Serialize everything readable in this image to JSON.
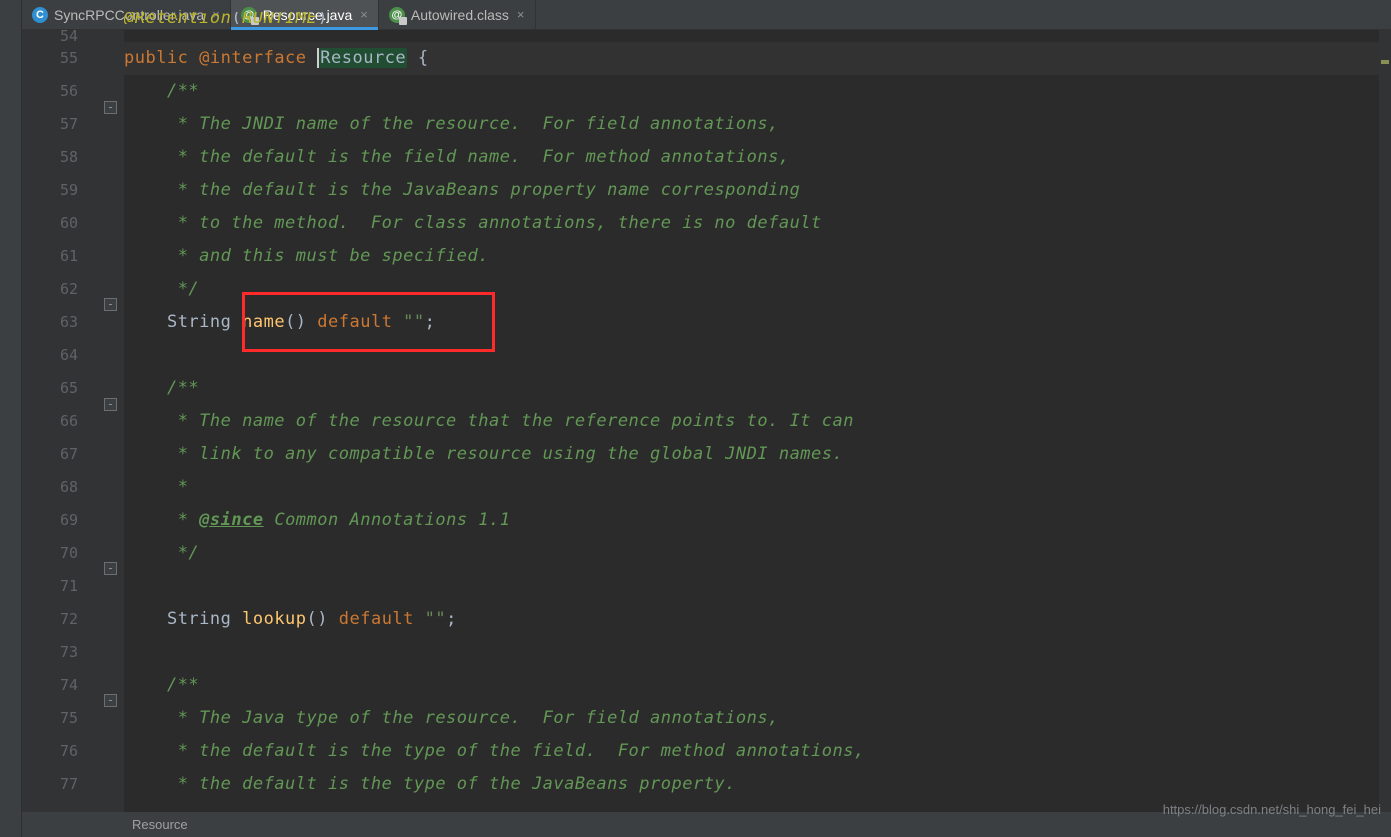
{
  "tabs": [
    {
      "icon": "class-icon",
      "label": "SyncRPCController.java",
      "active": false,
      "locked": false
    },
    {
      "icon": "annotation-icon",
      "label": "Resource.java",
      "active": true,
      "locked": true
    },
    {
      "icon": "annotation-icon",
      "label": "Autowired.class",
      "active": false,
      "locked": true
    }
  ],
  "line_numbers": [
    "54",
    "55",
    "56",
    "57",
    "58",
    "59",
    "60",
    "61",
    "62",
    "63",
    "64",
    "65",
    "66",
    "67",
    "68",
    "69",
    "70",
    "71",
    "72",
    "73",
    "74",
    "75",
    "76",
    "77"
  ],
  "fold_markers": [
    {
      "line": 54,
      "kind": "end"
    },
    {
      "line": 56,
      "kind": "start"
    },
    {
      "line": 62,
      "kind": "end"
    },
    {
      "line": 65,
      "kind": "start"
    },
    {
      "line": 70,
      "kind": "end"
    },
    {
      "line": 74,
      "kind": "start"
    }
  ],
  "code": {
    "l54": {
      "ann": "@Retention",
      "ann2": "RUNTIME"
    },
    "l55": {
      "kw1": "public",
      "kw2": "@interface",
      "id": "Resource",
      "brace": " {"
    },
    "l56": "/**",
    "l57": " * The JNDI name of the resource.  For field annotations,",
    "l58": " * the default is the field name.  For method annotations,",
    "l59": " * the default is the JavaBeans property name corresponding",
    "l60": " * to the method.  For class annotations, there is no default",
    "l61": " * and this must be specified.",
    "l62": " */",
    "l63": {
      "t": "String ",
      "m": "name",
      "p": "() ",
      "kw": "default ",
      "s": "\"\"",
      "e": ";"
    },
    "l64": "",
    "l65": "/**",
    "l66": " * The name of the resource that the reference points to. It can",
    "l67": " * link to any compatible resource using the global JNDI names.",
    "l68": " *",
    "l69a": " * ",
    "l69b": "@since",
    "l69c": " Common Annotations 1.1",
    "l70": " */",
    "l71": "",
    "l72": {
      "t": "String ",
      "m": "lookup",
      "p": "() ",
      "kw": "default ",
      "s": "\"\"",
      "e": ";"
    },
    "l73": "",
    "l74": "/**",
    "l75": " * The Java type of the resource.  For field annotations,",
    "l76": " * the default is the type of the field.  For method annotations,",
    "l77": " * the default is the type of the JavaBeans property."
  },
  "breadcrumb": "Resource",
  "watermark": "https://blog.csdn.net/shi_hong_fei_hei",
  "colors": {
    "highlight_box": "#ff2a2a",
    "keyword": "#cc7832",
    "annotation": "#bbb529",
    "comment": "#629755",
    "method": "#ffc66d",
    "string": "#6a8759",
    "active_tab_underline": "#3d9ae2"
  }
}
